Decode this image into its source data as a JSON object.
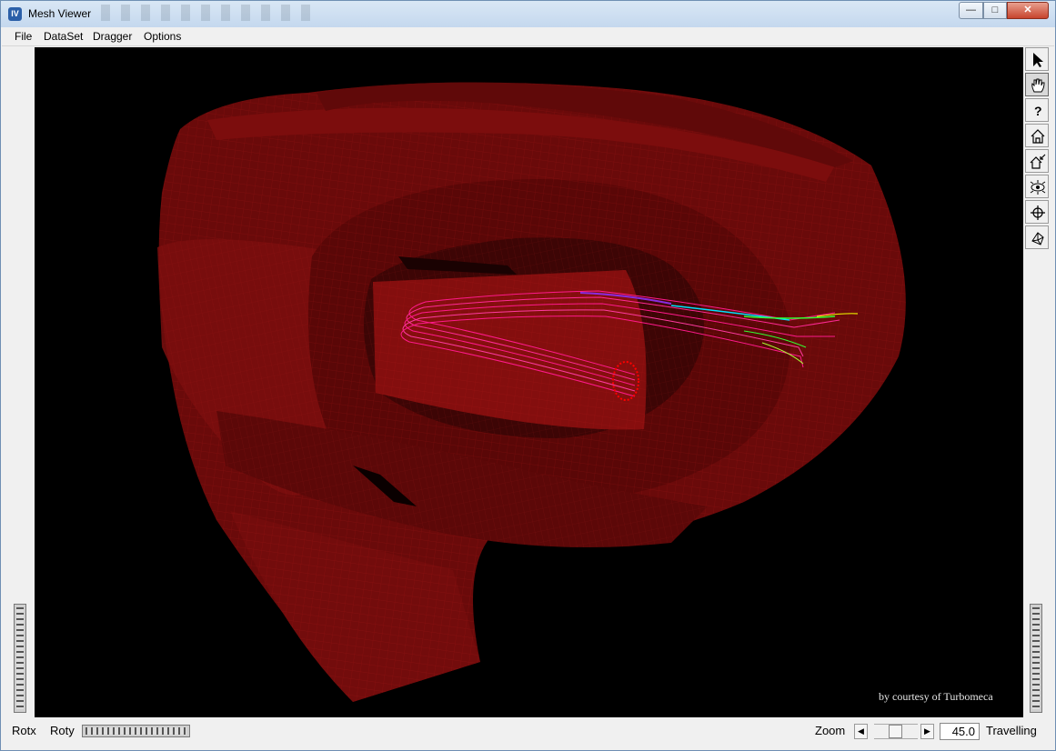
{
  "window": {
    "title": "Mesh Viewer"
  },
  "menu": [
    "File",
    "DataSet",
    "Dragger",
    "Options"
  ],
  "viewer": {
    "background": "#000000",
    "mesh_color": "#6e0b0b",
    "credit": "by courtesy of Turbomeca",
    "streamline_colors": [
      "#ff1a8c",
      "#8a2be2",
      "#00e0ff",
      "#33ff33",
      "#e6e600"
    ]
  },
  "tools": [
    {
      "name": "select-icon",
      "active": false
    },
    {
      "name": "view-hand-icon",
      "active": true
    },
    {
      "name": "help-icon",
      "active": false
    },
    {
      "name": "home-icon",
      "active": false
    },
    {
      "name": "set-home-icon",
      "active": false
    },
    {
      "name": "view-all-icon",
      "active": false
    },
    {
      "name": "seek-icon",
      "active": false
    },
    {
      "name": "perspective-icon",
      "active": false
    }
  ],
  "bottom": {
    "rotx_label": "Rotx",
    "roty_label": "Roty",
    "zoom_label": "Zoom",
    "zoom_value": "45.0",
    "travelling_label": "Travelling"
  }
}
